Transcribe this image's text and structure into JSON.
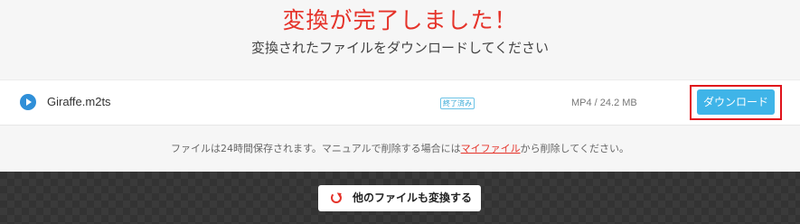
{
  "header": {
    "title": "変換が完了しました！",
    "subtitle": "変換されたファイルをダウンロードしてください"
  },
  "file": {
    "name": "Giraffe.m2ts",
    "status": "終了済み",
    "meta": "MP4 / 24.2 MB",
    "download_label": "ダウンロード"
  },
  "notice": {
    "before": "ファイルは24時間保存されます。マニュアルで削除する場合には",
    "link": "マイファイル",
    "after": "から削除してください。"
  },
  "footer": {
    "convert_more_label": "他のファイルも変換する"
  },
  "colors": {
    "accent_red": "#e5332a",
    "download_blue": "#3fb4e8"
  }
}
